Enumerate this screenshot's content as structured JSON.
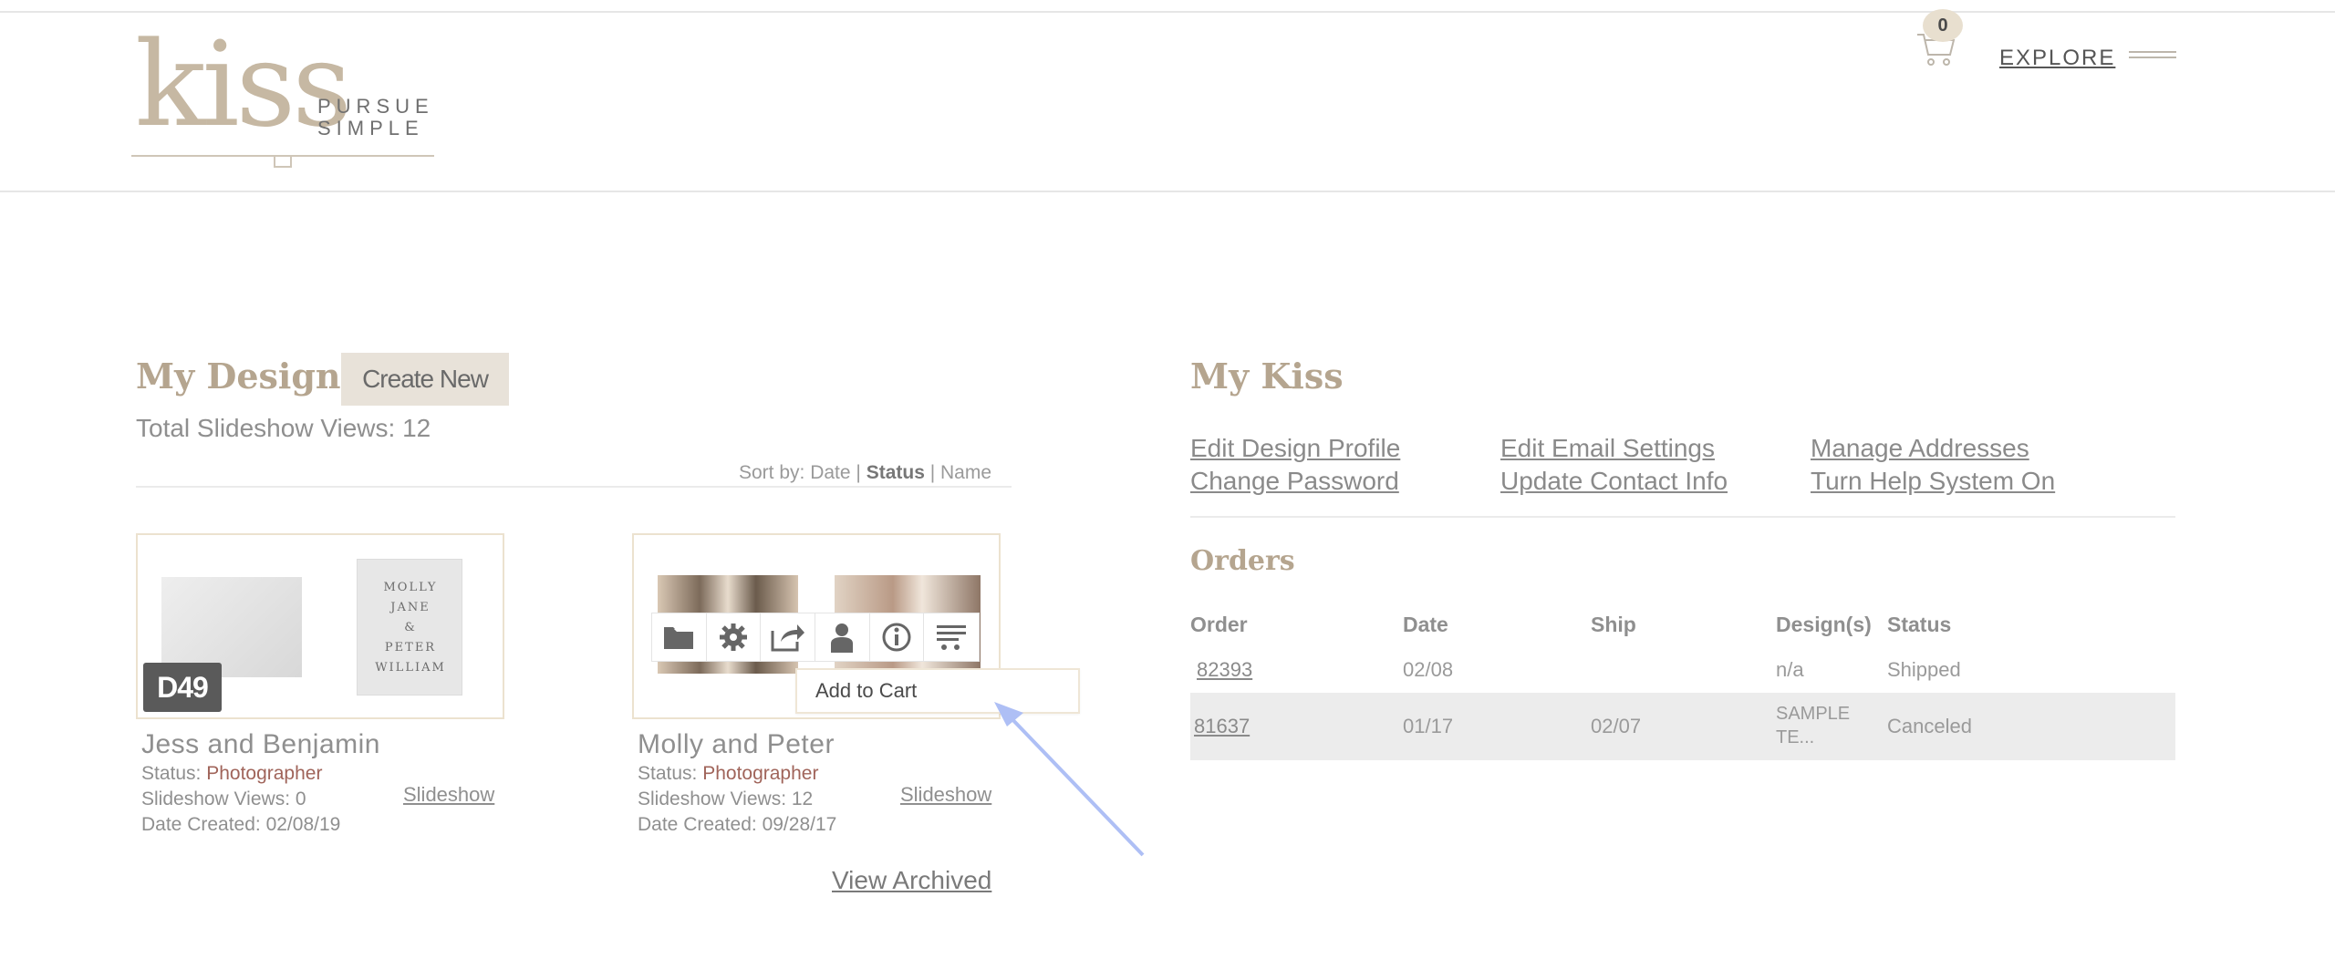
{
  "logo": {
    "word": "kiss",
    "line1": "PURSUE",
    "line2": "SIMPLE"
  },
  "nav": {
    "cart_count": "0",
    "explore_label": "EXPLORE"
  },
  "designs": {
    "title": "My Designs",
    "create_new_label": "Create New",
    "total_views": "Total Slideshow Views: 12",
    "sort_prefix": "Sort by: ",
    "sort_options": [
      "Date",
      "Status",
      "Name"
    ],
    "sort_sep": " | ",
    "cards": [
      {
        "title": "Jess and Benjamin",
        "status_label": "Status: ",
        "status_value": "Photographer",
        "views": "Slideshow Views: 0",
        "created": "Date Created: 02/08/19",
        "slideshow_label": "Slideshow",
        "badge": "D49",
        "invite_text": [
          "MOLLY",
          "JANE",
          "&",
          "PETER",
          "WILLIAM"
        ]
      },
      {
        "title": "Molly and Peter",
        "status_label": "Status: ",
        "status_value": "Photographer",
        "views": "Slideshow Views: 12",
        "created": "Date Created: 09/28/17",
        "slideshow_label": "Slideshow"
      }
    ],
    "context_menu_item": "Add to Cart",
    "view_archived": "View Archived"
  },
  "mykiss": {
    "title": "My Kiss",
    "links": [
      "Edit Design Profile",
      "Edit Email Settings",
      "Manage Addresses",
      "Change Password",
      "Update Contact Info",
      "Turn Help System On"
    ],
    "orders_title": "Orders",
    "columns": [
      "Order",
      "Date",
      "Ship",
      "Design(s)",
      "Status"
    ],
    "rows": [
      {
        "order": "82393",
        "date": "02/08",
        "ship": "",
        "designs": "n/a",
        "designs_2": "",
        "status": "Shipped"
      },
      {
        "order": "81637",
        "date": "01/17",
        "ship": "02/07",
        "designs": "SAMPLE",
        "designs_2": "TE...",
        "status": "Canceled"
      }
    ]
  },
  "colors": {
    "accent": "#b5a58f",
    "status_value": "#a0645a",
    "annotation_arrow": "#aebff5"
  }
}
